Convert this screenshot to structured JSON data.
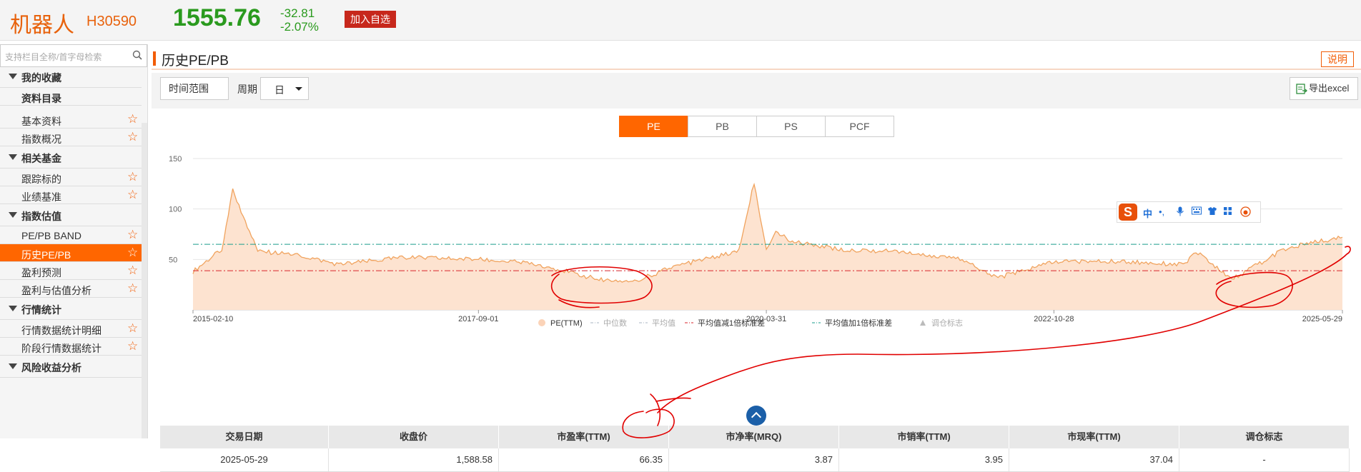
{
  "header": {
    "name": "机器人",
    "code": "H30590",
    "price": "1555.76",
    "change": "-32.81",
    "change_pct": "-2.07%",
    "add_label": "加入自选",
    "colors": {
      "accent": "#e8620c",
      "down": "#2a9a1e",
      "add_btn": "#c7281c"
    }
  },
  "sidebar": {
    "search_placeholder": "支持栏目全称/首字母检索",
    "rows": [
      {
        "type": "group",
        "label": "我的收藏"
      },
      {
        "type": "plain",
        "label": "资料目录"
      },
      {
        "type": "item",
        "label": "基本资料"
      },
      {
        "type": "item",
        "label": "指数概况"
      },
      {
        "type": "group",
        "label": "相关基金"
      },
      {
        "type": "item",
        "label": "跟踪标的"
      },
      {
        "type": "item",
        "label": "业绩基准"
      },
      {
        "type": "group",
        "label": "指数估值"
      },
      {
        "type": "item",
        "label": "PE/PB BAND"
      },
      {
        "type": "item",
        "label": "历史PE/PB",
        "active": true
      },
      {
        "type": "item",
        "label": "盈利预测"
      },
      {
        "type": "item",
        "label": "盈利与估值分析"
      },
      {
        "type": "group",
        "label": "行情统计"
      },
      {
        "type": "item",
        "label": "行情数据统计明细"
      },
      {
        "type": "item",
        "label": "阶段行情数据统计"
      },
      {
        "type": "group",
        "label": "风险收益分析"
      }
    ]
  },
  "main": {
    "title": "历史PE/PB",
    "explain_label": "说明",
    "toolbar": {
      "time_range_label": "时间范围",
      "period_label": "周期",
      "period_value": "日",
      "export_label": "导出excel"
    },
    "tabs": [
      "PE",
      "PB",
      "PS",
      "PCF"
    ],
    "active_tab": "PE"
  },
  "chart_data": {
    "type": "area",
    "x_ticks": [
      "2015-02-10",
      "2017-09-01",
      "2020-03-31",
      "2022-10-28",
      "2025-05-29"
    ],
    "y_ticks": [
      50,
      100,
      150
    ],
    "ylim": [
      0,
      150
    ],
    "series": [
      {
        "name": "PE(TTM)",
        "color": "#f0a35e",
        "fill": "#fde3d0",
        "x": [
          "2015-02-10",
          "2015-05-15",
          "2015-06-20",
          "2015-09-10",
          "2016-01-10",
          "2016-06-01",
          "2017-01-01",
          "2017-09-01",
          "2018-03-01",
          "2018-10-01",
          "2019-02-01",
          "2019-06-01",
          "2020-01-01",
          "2020-02-20",
          "2020-03-31",
          "2020-05-01",
          "2020-07-01",
          "2020-12-01",
          "2021-06-01",
          "2022-01-01",
          "2022-04-28",
          "2022-10-28",
          "2023-06-01",
          "2024-01-01",
          "2024-02-05",
          "2024-06-01",
          "2024-12-01",
          "2025-05-29"
        ],
        "values": [
          38,
          60,
          118,
          58,
          55,
          45,
          52,
          50,
          46,
          30,
          29,
          43,
          58,
          126,
          60,
          77,
          67,
          60,
          58,
          50,
          32,
          48,
          48,
          45,
          58,
          30,
          62,
          72
        ]
      }
    ],
    "bands": [
      {
        "name": "中位数",
        "value": 48.5,
        "color": "#9aa7b6",
        "style": "dash-dot"
      },
      {
        "name": "平均值",
        "value": 51.0,
        "color": "#9aa7b6",
        "style": "dash-dot"
      },
      {
        "name": "平均值减1倍标准差",
        "value": 38.8,
        "color": "#d8252b",
        "style": "dash-dot"
      },
      {
        "name": "平均值加1倍标准差",
        "value": 65.0,
        "color": "#1a9e8c",
        "style": "dash-dot"
      },
      {
        "name": "调仓标志",
        "value": null,
        "color": "#bbbbbb",
        "style": "triangle"
      }
    ],
    "legend": [
      "PE(TTM)",
      "中位数",
      "平均值",
      "平均值减1倍标准差",
      "平均值加1倍标准差",
      "调仓标志"
    ],
    "legend_position": "bottom",
    "grid": true
  },
  "ime_bar": {
    "logo": "S",
    "icons": [
      "中",
      "•,",
      "mic-icon",
      "keyboard-icon",
      "shirt-icon",
      "grid-icon",
      "face-icon"
    ]
  },
  "table": {
    "headers": [
      "交易日期",
      "收盘价",
      "市盈率(TTM)",
      "市净率(MRQ)",
      "市销率(TTM)",
      "市现率(TTM)",
      "调仓标志"
    ],
    "rows": [
      [
        "2025-05-29",
        "1,588.58",
        "66.35",
        "3.87",
        "3.95",
        "37.04",
        "-"
      ]
    ]
  }
}
